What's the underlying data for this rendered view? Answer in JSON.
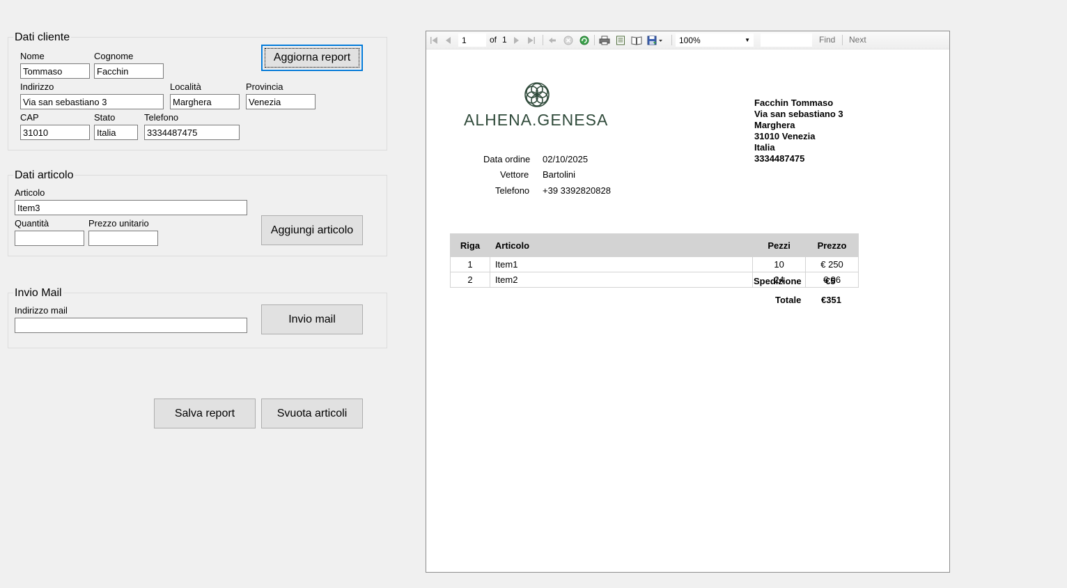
{
  "customer": {
    "group_title": "Dati cliente",
    "nome_label": "Nome",
    "nome_value": "Tommaso",
    "cognome_label": "Cognome",
    "cognome_value": "Facchin",
    "indirizzo_label": "Indirizzo",
    "indirizzo_value": "Via san sebastiano 3",
    "localita_label": "Località",
    "localita_value": "Marghera",
    "provincia_label": "Provincia",
    "provincia_value": "Venezia",
    "cap_label": "CAP",
    "cap_value": "31010",
    "stato_label": "Stato",
    "stato_value": "Italia",
    "telefono_label": "Telefono",
    "telefono_value": "3334487475",
    "update_button": "Aggiorna report"
  },
  "article": {
    "group_title": "Dati articolo",
    "articolo_label": "Articolo",
    "articolo_value": "Item3",
    "quantita_label": "Quantità",
    "quantita_value": "",
    "prezzo_label": "Prezzo unitario",
    "prezzo_value": "",
    "add_button": "Aggiungi articolo"
  },
  "mail": {
    "group_title": "Invio Mail",
    "address_label": "Indirizzo mail",
    "address_value": "",
    "send_button": "Invio mail"
  },
  "actions": {
    "save_button": "Salva report",
    "clear_button": "Svuota articoli"
  },
  "viewer": {
    "toolbar": {
      "page_value": "1",
      "of_label": "of",
      "total_pages": "1",
      "zoom_value": "100%",
      "find_value": "",
      "find_label": "Find",
      "next_label": "Next",
      "icons": [
        "first-page-icon",
        "prev-page-icon",
        "next-page-icon",
        "last-page-icon",
        "back-icon",
        "stop-icon",
        "refresh-icon",
        "print-icon",
        "print-layout-icon",
        "page-setup-icon",
        "export-icon"
      ]
    },
    "report": {
      "logo_text": "ALHENA.GENESA",
      "order_date_label": "Data ordine",
      "order_date_value": "02/10/2025",
      "carrier_label": "Vettore",
      "carrier_value": "Bartolini",
      "phone_label": "Telefono",
      "phone_value": "+39 3392820828",
      "recipient": {
        "name": "Facchin Tommaso",
        "street": "Via san sebastiano 3",
        "locality": "Marghera",
        "cap_city": "31010 Venezia",
        "country": "Italia",
        "phone": "3334487475"
      },
      "table": {
        "headers": [
          "Riga",
          "Articolo",
          "Pezzi",
          "Prezzo"
        ],
        "rows": [
          [
            "1",
            "Item1",
            "10",
            "€ 250"
          ],
          [
            "2",
            "Item2",
            "24",
            "€ 96"
          ]
        ]
      },
      "shipping_label": "Spedizione",
      "shipping_value": "€5",
      "total_label": "Totale",
      "total_value": "€351",
      "logo_color": "#2f4a3a"
    }
  }
}
